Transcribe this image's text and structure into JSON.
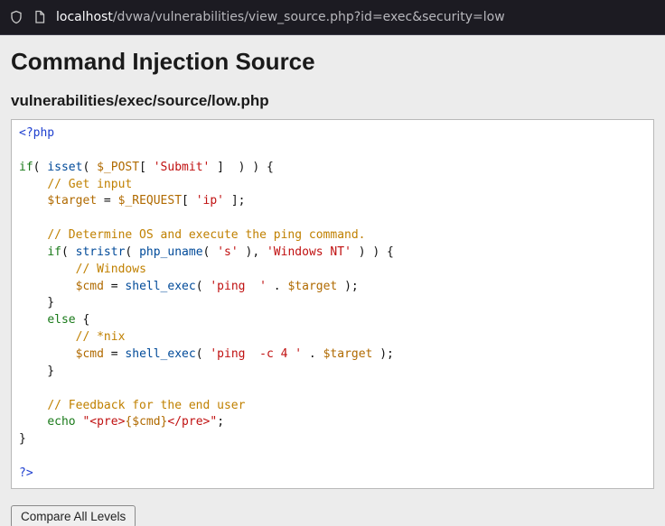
{
  "browser": {
    "url_host": "localhost",
    "url_path": "/dvwa/vulnerabilities/view_source.php?id=exec&security=low"
  },
  "page": {
    "title": "Command Injection Source",
    "subtitle": "vulnerabilities/exec/source/low.php",
    "compare_button_label": "Compare All Levels"
  },
  "code": {
    "open_tag": "<?php",
    "close_tag": "?>",
    "if_keyword": "if",
    "else_keyword": "else",
    "echo_keyword": "echo",
    "isset_fn": "isset",
    "stristr_fn": "stristr",
    "php_uname_fn": "php_uname",
    "shell_exec_fn": "shell_exec",
    "var_post": "$_POST",
    "var_request": "$_REQUEST",
    "var_target": "$target",
    "var_cmd": "$cmd",
    "str_submit": "'Submit'",
    "str_ip": "'ip'",
    "str_s": "'s'",
    "str_windows_nt": "'Windows NT'",
    "str_ping": "'ping  '",
    "str_ping_c4": "'ping  -c 4 '",
    "comment_get_input": "// Get input",
    "comment_determine": "// Determine OS and execute the ping command.",
    "comment_windows": "// Windows",
    "comment_nix": "// *nix",
    "comment_feedback": "// Feedback for the end user",
    "echo_open": "\"<pre>",
    "echo_mid": "{$cmd}",
    "echo_close": "</pre>\""
  }
}
